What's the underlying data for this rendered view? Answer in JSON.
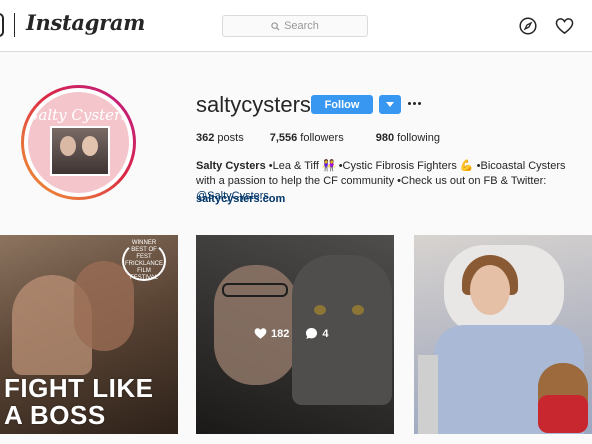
{
  "nav": {
    "brand": "Instagram",
    "search_placeholder": "Search",
    "icons": [
      "instagram-glyph-icon",
      "search-icon",
      "compass-icon",
      "heart-icon"
    ]
  },
  "profile": {
    "avatar_text": "Salty Cysters",
    "username": "saltycysters",
    "follow_label": "Follow",
    "more_label": "···",
    "stats": {
      "posts_count": "362",
      "posts_label": " posts",
      "followers_count": "7,556",
      "followers_label": " followers",
      "following_count": "980",
      "following_label": " following"
    },
    "bio": {
      "name": "Salty Cysters",
      "text": " •Lea & Tiff 👭 •Cystic Fibrosis Fighters 💪 •Bicoastal Cysters with a passion to help the CF community •Check us out on FB & Twitter: ",
      "handle": "@SaltyCysters"
    },
    "website": "saltycysters.com"
  },
  "posts": [
    {
      "award_line1": "WINNER",
      "award_line2": "BEST OF FEST",
      "award_line3": "FRICKLANCE FILM FESTIVAL",
      "headline": "FIGHT LIKE A BOSS"
    },
    {
      "likes": "182",
      "comments": "4"
    },
    {}
  ],
  "colors": {
    "accent": "#3897f0",
    "link": "#003569",
    "text": "#262626",
    "border": "#dbdbdb"
  }
}
